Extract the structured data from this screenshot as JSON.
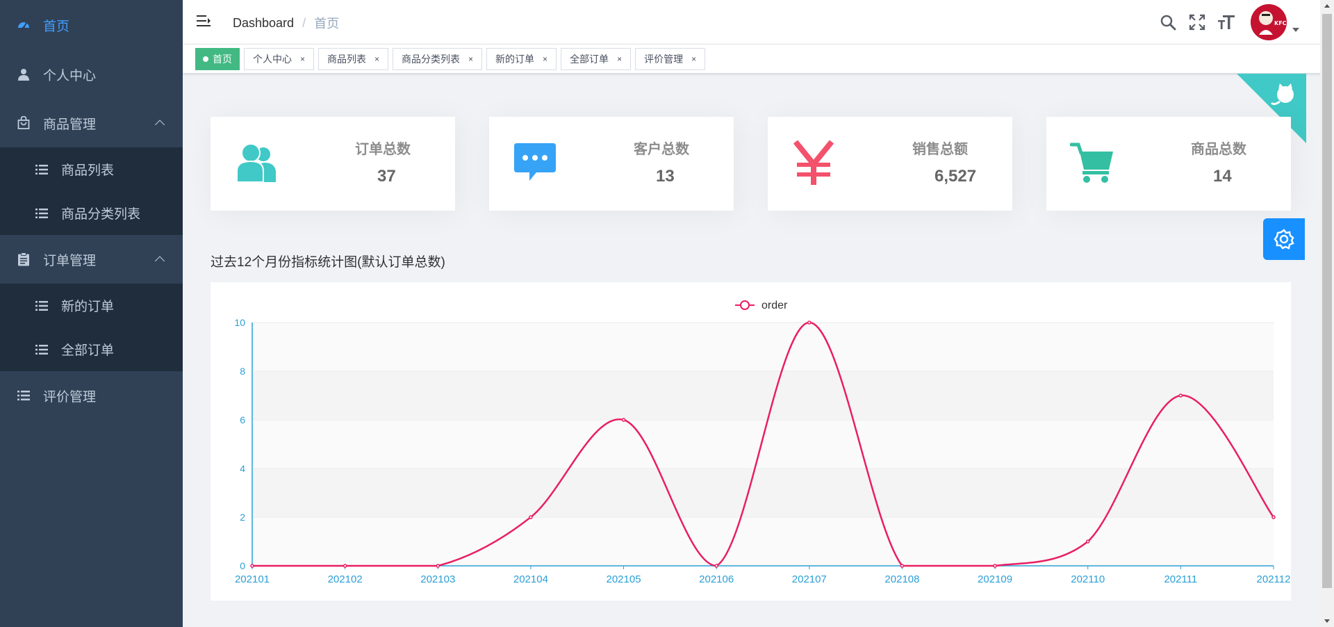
{
  "sidebar": {
    "items": [
      {
        "label": "首页",
        "icon": "dashboard-icon",
        "active": true
      },
      {
        "label": "个人中心",
        "icon": "user-icon"
      },
      {
        "label": "商品管理",
        "icon": "shopping-bag-icon",
        "expanded": true,
        "children": [
          {
            "label": "商品列表",
            "icon": "list-icon"
          },
          {
            "label": "商品分类列表",
            "icon": "list-icon"
          }
        ]
      },
      {
        "label": "订单管理",
        "icon": "clipboard-icon",
        "expanded": true,
        "children": [
          {
            "label": "新的订单",
            "icon": "list-icon"
          },
          {
            "label": "全部订单",
            "icon": "list-icon"
          }
        ]
      },
      {
        "label": "评价管理",
        "icon": "list-icon"
      }
    ]
  },
  "navbar": {
    "breadcrumb": [
      "Dashboard",
      "首页"
    ],
    "breadcrumb_sep": "/",
    "icons": [
      "search-icon",
      "fullscreen-icon",
      "font-size-icon"
    ],
    "avatar_text": "KFC"
  },
  "tags": [
    {
      "label": "首页",
      "active": true
    },
    {
      "label": "个人中心"
    },
    {
      "label": "商品列表"
    },
    {
      "label": "商品分类列表"
    },
    {
      "label": "新的订单"
    },
    {
      "label": "全部订单"
    },
    {
      "label": "评价管理"
    }
  ],
  "tag_close": "×",
  "cards": [
    {
      "label": "订单总数",
      "value": "37",
      "icon": "users-icon",
      "color": "#40c9c6"
    },
    {
      "label": "客户总数",
      "value": "13",
      "icon": "message-icon",
      "color": "#36a3f7"
    },
    {
      "label": "销售总额",
      "value": "6,527",
      "icon": "yen-icon",
      "color": "#f4516c"
    },
    {
      "label": "商品总数",
      "value": "14",
      "icon": "cart-icon",
      "color": "#34bfa3"
    }
  ],
  "chart_title": "过去12个月份指标统计图(默认订单总数)",
  "chart_data": {
    "type": "line",
    "categories": [
      "202101",
      "202102",
      "202103",
      "202104",
      "202105",
      "202106",
      "202107",
      "202108",
      "202109",
      "202110",
      "202111",
      "202112"
    ],
    "series": [
      {
        "name": "order",
        "values": [
          0,
          0,
          0,
          2,
          6,
          0,
          10,
          0,
          0,
          1,
          7,
          2
        ]
      }
    ],
    "ylim": [
      0,
      10
    ],
    "yticks": [
      0,
      2,
      4,
      6,
      8,
      10
    ],
    "smooth": true,
    "line_color": "#e91e63",
    "axis_color": "#2a9fd6",
    "legend_position": "top-center"
  },
  "colors": {
    "sidebar_bg": "#304156",
    "submenu_bg": "#1f2d3d",
    "active": "#409eff",
    "tag_active": "#42b983",
    "corner": "#40c9c6",
    "settings": "#1890ff"
  }
}
